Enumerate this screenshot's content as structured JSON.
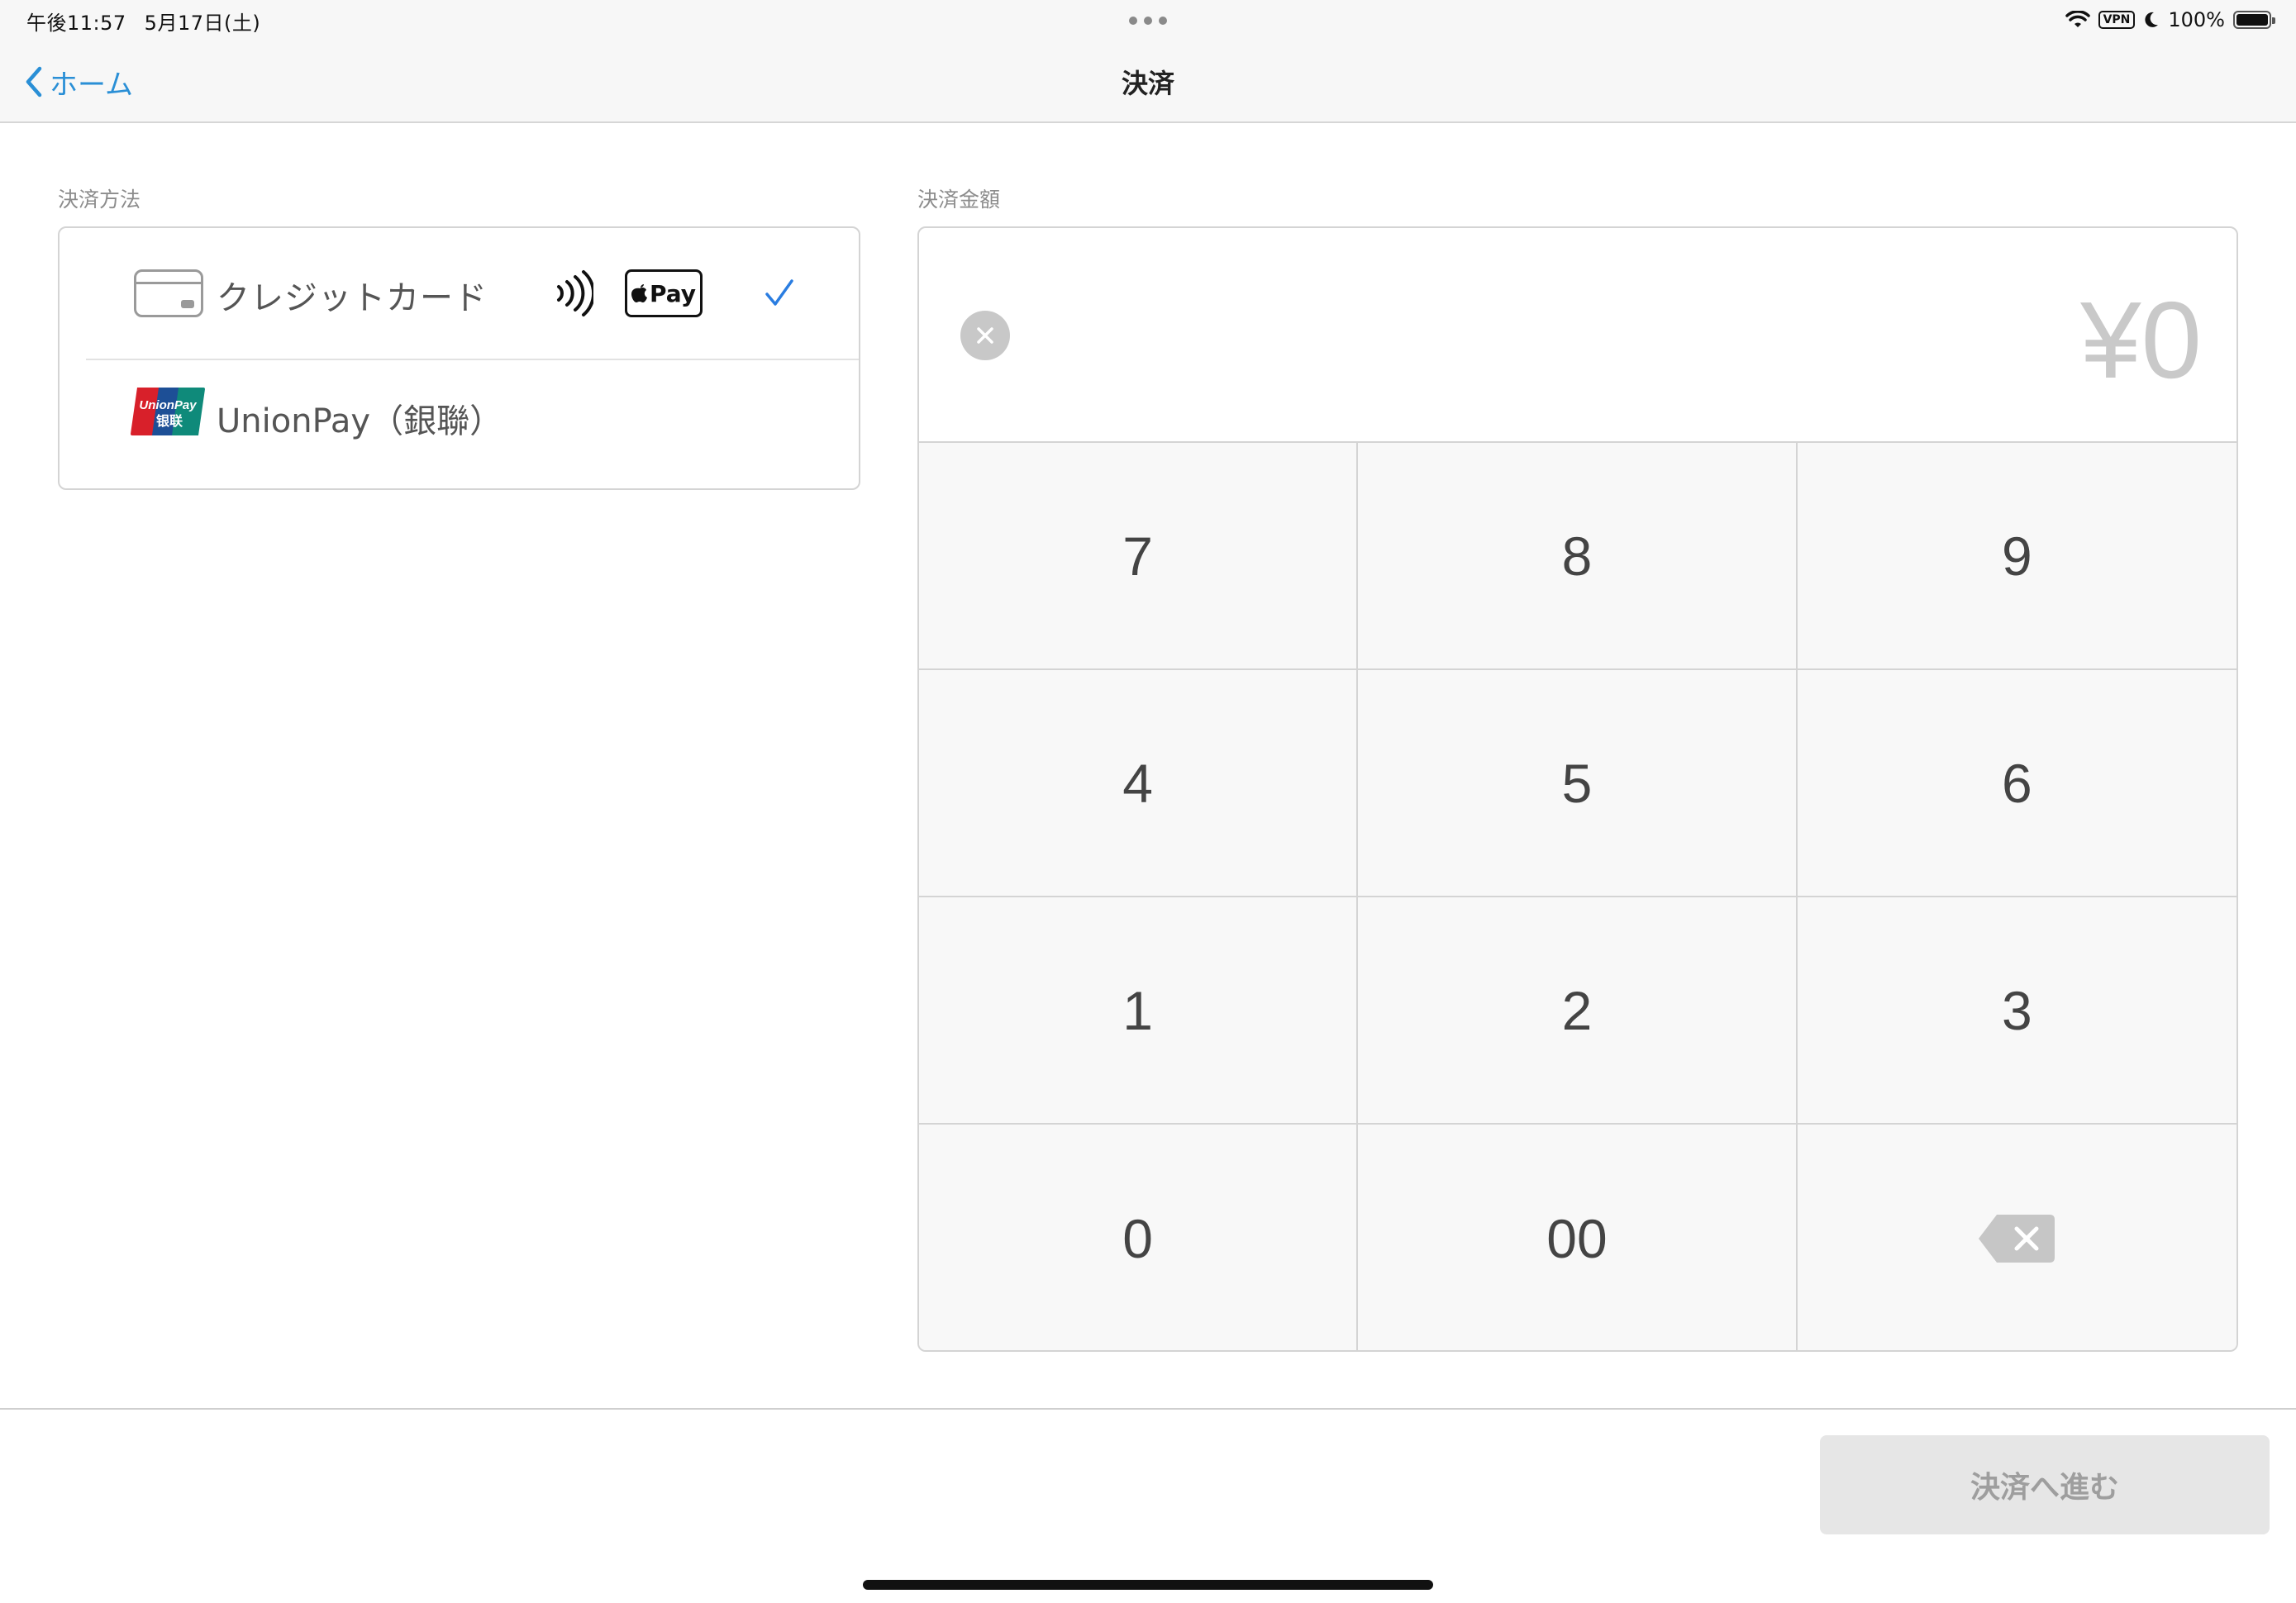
{
  "status_bar": {
    "time": "午後11:57",
    "date": "5月17日(土)",
    "vpn": "VPN",
    "battery": "100%",
    "icons": [
      "wifi-icon",
      "vpn-icon",
      "moon-icon",
      "battery-icon"
    ]
  },
  "nav": {
    "back_label": "ホーム",
    "title": "決済"
  },
  "payment_methods": {
    "section_label": "決済方法",
    "items": [
      {
        "label": "クレジットカード",
        "icon": "credit-card-icon",
        "badges": [
          "contactless-icon",
          "apple-pay-icon"
        ],
        "apple_pay_text": "Pay",
        "selected": true
      },
      {
        "label": "UnionPay（銀聯）",
        "icon": "unionpay-logo",
        "logo_text_top": "UnionPay",
        "logo_text_bottom": "银联",
        "selected": false
      }
    ]
  },
  "amount": {
    "section_label": "決済金額",
    "value": "¥0",
    "keys": [
      "7",
      "8",
      "9",
      "4",
      "5",
      "6",
      "1",
      "2",
      "3",
      "0",
      "00",
      "backspace-icon"
    ]
  },
  "footer": {
    "proceed_label": "決済へ進む",
    "proceed_enabled": false
  },
  "colors": {
    "accent": "#2a8fd6",
    "check": "#2a7de1",
    "disabled_button": "#e6e6e6",
    "amount_placeholder": "#c9c9c9"
  }
}
